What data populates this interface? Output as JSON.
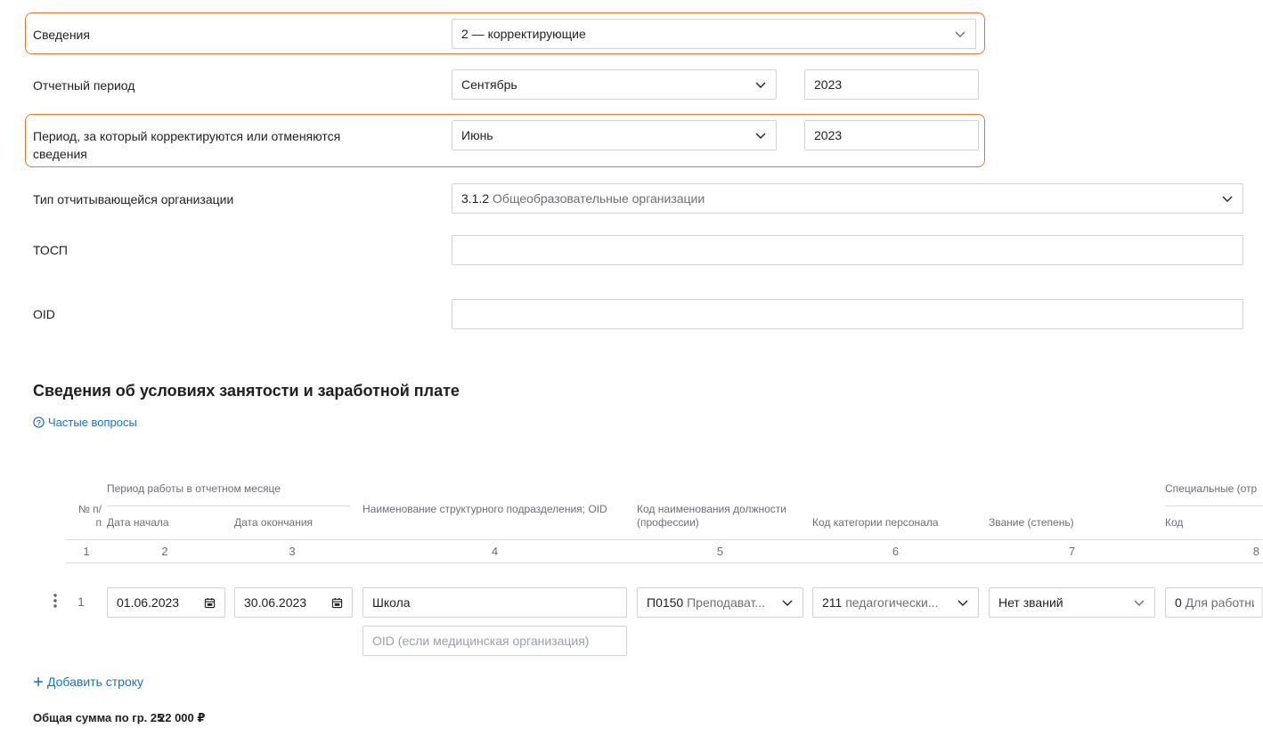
{
  "form": {
    "svedeniya": {
      "label": "Сведения",
      "value": "2 — корректирующие"
    },
    "report_period": {
      "label": "Отчетный период",
      "month": "Сентябрь",
      "year": "2023"
    },
    "corr_period": {
      "label_line1": "Период, за который корректируются или отменяются",
      "label_line2": "сведения",
      "month": "Июнь",
      "year": "2023"
    },
    "org_type": {
      "label": "Тип отчитывающейся организации",
      "code": "3.1.2",
      "name": "Общеобразовательные организации"
    },
    "tosp": {
      "label": "ТОСП",
      "value": ""
    },
    "oid": {
      "label": "OID",
      "value": ""
    }
  },
  "section": {
    "title": "Сведения об условиях занятости и заработной плате",
    "faq_link": "Частые вопросы"
  },
  "table": {
    "headers": {
      "num": "№ п/п",
      "period_group": "Период работы в отчетном месяце",
      "start": "Дата начала",
      "end": "Дата окончания",
      "subdivision": "Наименование структурного подразделения; OID",
      "position_code": "Код наименования должности (профессии)",
      "category_code": "Код категории персонала",
      "rank": "Звание (степень)",
      "special_group": "Специальные (отр",
      "special_code": "Код"
    },
    "col_numbers": [
      "1",
      "2",
      "3",
      "4",
      "5",
      "6",
      "7",
      "8"
    ],
    "rows": [
      {
        "num": "1",
        "start": "01.06.2023",
        "end": "30.06.2023",
        "subdivision": "Школа",
        "oid_placeholder": "OID (если медицинская организация)",
        "position_code": "П0150",
        "position_name": "Преподават...",
        "category_code": "211",
        "category_name": "педагогически...",
        "rank": "Нет званий",
        "special_code": "0",
        "special_name": "Для работни"
      }
    ],
    "add_row": "Добавить строку"
  },
  "totals": {
    "label": "Общая сумма по гр. 25",
    "value": "22 000 ₽"
  },
  "colors": {
    "highlight": "#e8762c",
    "link": "#1a6fc9",
    "border": "#cfd3d8"
  }
}
